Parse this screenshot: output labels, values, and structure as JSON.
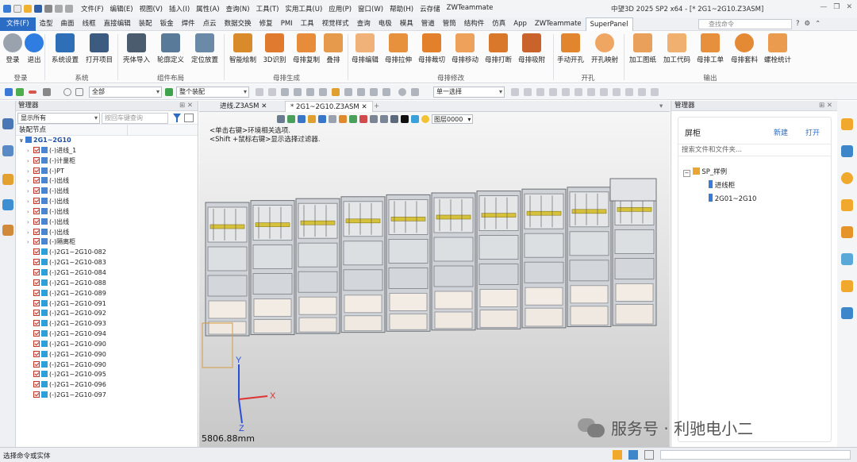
{
  "titlebar": {
    "menus": [
      "文件(F)",
      "编辑(E)",
      "视图(V)",
      "插入(I)",
      "属性(A)",
      "查询(N)",
      "工具(T)",
      "实用工具(U)",
      "应用(P)",
      "窗口(W)",
      "帮助(H)",
      "云存储",
      "ZWTeammate"
    ],
    "window_title": "中望3D 2025 SP2 x64 - [* 2G1~2G10.Z3ASM]"
  },
  "ribbon_tabs": [
    "文件(F)",
    "造型",
    "曲面",
    "线框",
    "直接编辑",
    "装配",
    "钣金",
    "焊件",
    "点云",
    "数据交换",
    "修复",
    "PMI",
    "工具",
    "视觉样式",
    "查询",
    "电极",
    "模具",
    "管道",
    "管筒",
    "结构件",
    "仿真",
    "App",
    "ZWTeammate",
    "SuperPanel"
  ],
  "tab_search": {
    "placeholder": "查找命令"
  },
  "ribbon": {
    "buttons": [
      "登录",
      "退出",
      "系统设置",
      "打开项目",
      "壳体导入",
      "轮廓定义",
      "定位放置",
      "智能绘制",
      "3D识别",
      "母排复制",
      "叠排",
      "母排编辑",
      "母排拉伸",
      "母排裁切",
      "母排移动",
      "母排打断",
      "母排吸附",
      "手动开孔",
      "开孔映射",
      "加工图纸",
      "加工代码",
      "母排工单",
      "母排套料",
      "螺栓统计"
    ],
    "groups": [
      "登录",
      "系统",
      "组件布局",
      "母排生成",
      "母排修改",
      "开孔",
      "输出"
    ]
  },
  "toolbar2": {
    "filter_value": "全部",
    "assembly_value": "整个装配",
    "select_mode": "单一选择"
  },
  "manager": {
    "title": "管理器",
    "display_filter": "显示所有",
    "search_placeholder": "按回车键查询",
    "tree_header": "装配节点",
    "root": "2G1~2G10",
    "assemblies": [
      "(-)进线_1",
      "(-)计量柜",
      "(-)PT",
      "(-)出线",
      "(-)出线",
      "(-)出线",
      "(-)出线",
      "(-)出线",
      "(-)出线",
      "(-)隔离柜"
    ],
    "parts": [
      "(-)2G1~2G10-082",
      "(-)2G1~2G10-083",
      "(-)2G1~2G10-084",
      "(-)2G1~2G10-088",
      "(-)2G1~2G10-089",
      "(-)2G1~2G10-091",
      "(-)2G1~2G10-092",
      "(-)2G1~2G10-093",
      "(-)2G1~2G10-094",
      "(-)2G1~2G10-090",
      "(-)2G1~2G10-090",
      "(-)2G1~2G10-090",
      "(-)2G1~2G10-095",
      "(-)2G1~2G10-096",
      "(-)2G1~2G10-097"
    ]
  },
  "doc_tabs": [
    "进线.Z3ASM",
    "* 2G1~2G10.Z3ASM"
  ],
  "viewport": {
    "layer": "图层0000",
    "hint1": "<单击右键>环境相关选项.",
    "hint2": "<Shift +鼠标右键>显示选择过滤器.",
    "distance": "5806.88mm",
    "axes": [
      "X",
      "Y",
      "Z"
    ]
  },
  "right_panel": {
    "title": "管理器",
    "heading": "屏柜",
    "new_label": "新建",
    "open_label": "打开",
    "search_placeholder": "搜索文件和文件夹...",
    "tree_root": "SP_样例",
    "tree_items": [
      "进线柜",
      "2G01~2G10"
    ]
  },
  "status": {
    "prompt": "选择命令或实体"
  },
  "watermark": "服务号 · 利驰电小二",
  "colors": {
    "accent": "#2b6cc4",
    "check": "#c0392b",
    "cabinet_yellow": "#d6c23a"
  }
}
